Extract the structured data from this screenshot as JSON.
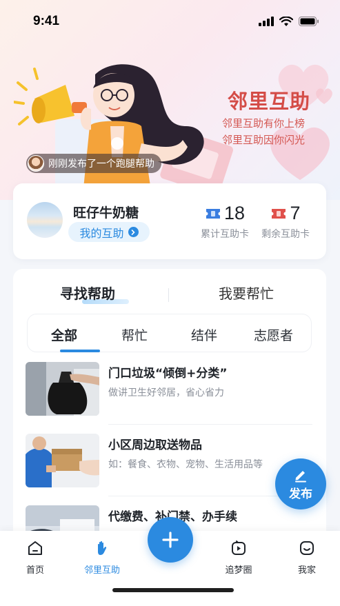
{
  "status_bar": {
    "time": "9:41"
  },
  "hero": {
    "title": "邻里互助",
    "line1": "邻里互助有你上榜",
    "line2": "邻里互助因你闪光",
    "notice": "刚刚发布了一个跑腿帮助"
  },
  "user": {
    "name": "旺仔牛奶糖",
    "my_help_label": "我的互助",
    "stats": [
      {
        "value": "18",
        "label": "累计互助卡",
        "color": "#3a7de0"
      },
      {
        "value": "7",
        "label": "剩余互助卡",
        "color": "#e0504b"
      }
    ]
  },
  "main_tabs": [
    {
      "label": "寻找帮助",
      "active": true
    },
    {
      "label": "我要帮忙",
      "active": false
    }
  ],
  "segments": [
    {
      "label": "全部",
      "active": true
    },
    {
      "label": "帮忙",
      "active": false
    },
    {
      "label": "结伴",
      "active": false
    },
    {
      "label": "志愿者",
      "active": false
    }
  ],
  "list": [
    {
      "title": "门口垃圾“倾倒+分类”",
      "subtitle": "做讲卫生好邻居，省心省力",
      "thumb_icon": "trash-bag-photo"
    },
    {
      "title": "小区周边取送物品",
      "subtitle": "如：餐食、衣物、宠物、生活用品等",
      "thumb_icon": "delivery-photo"
    },
    {
      "title": "代缴费、补门禁、办手续",
      "subtitle": "",
      "thumb_icon": "paperwork-photo"
    }
  ],
  "fab_publish": {
    "label": "发布",
    "icon": "pen-icon"
  },
  "tabbar": [
    {
      "label": "首页",
      "icon": "home-icon",
      "active": false
    },
    {
      "label": "邻里互助",
      "icon": "hand-icon",
      "active": true
    },
    {
      "label": "追梦圈",
      "icon": "play-icon",
      "active": false
    },
    {
      "label": "我家",
      "icon": "smile-icon",
      "active": false
    }
  ],
  "colors": {
    "accent": "#2b8ae0",
    "hero_red": "#d44c47"
  }
}
